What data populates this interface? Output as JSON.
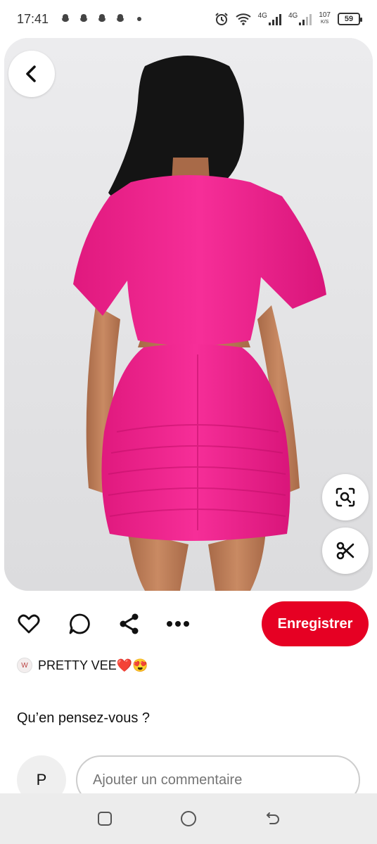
{
  "status_bar": {
    "time": "17:41",
    "network1": "4G",
    "network2": "4G",
    "speed_value": "107",
    "speed_unit": "K/S",
    "battery": "59"
  },
  "pin": {
    "image_description_icon": "product-photo",
    "accent_color": "#e60023"
  },
  "actions": {
    "save_label": "Enregistrer"
  },
  "board": {
    "name": "PRETTY VEE❤️😍"
  },
  "comments": {
    "question": "Qu’en pensez-vous ?",
    "user_initial": "P",
    "placeholder": "Ajouter un commentaire"
  },
  "icons": {
    "back": "chevron-left-icon",
    "lens": "visual-search-icon",
    "scissors": "scissors-icon",
    "like": "heart-icon",
    "comment": "comment-icon",
    "share": "share-icon",
    "more": "more-icon"
  }
}
